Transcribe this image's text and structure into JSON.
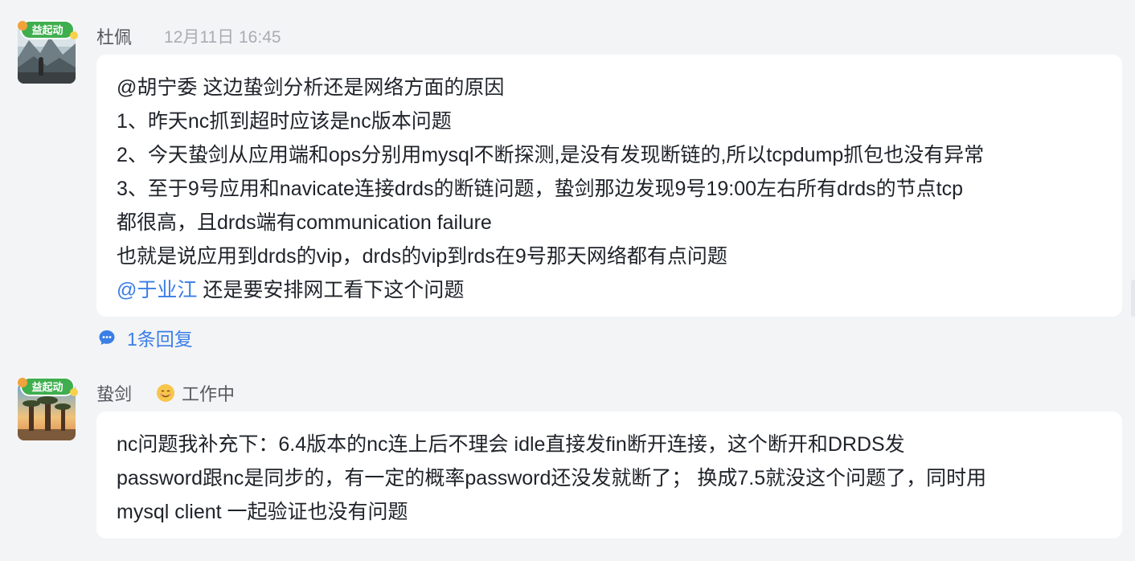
{
  "messages": [
    {
      "sender": "杜佩",
      "time": "12月11日 16:45",
      "badge": "益起动",
      "lines": [
        [
          {
            "text": "@胡宁委 这边蛰剑分析还是网络方面的原因"
          }
        ],
        [
          {
            "text": "1、昨天nc抓到超时应该是nc版本问题"
          }
        ],
        [
          {
            "text": "2、今天蛰剑从应用端和ops分别用mysql不断探测,是没有发现断链的,所以tcpdump抓包也没有异常"
          }
        ],
        [
          {
            "text": "3、至于9号应用和navicate连接drds的断链问题，蛰剑那边发现9号19:00左右所有drds的节点tcp"
          }
        ],
        [
          {
            "text": "都很高，且drds端有communication failure"
          }
        ],
        [
          {
            "text": "也就是说应用到drds的vip，drds的vip到rds在9号那天网络都有点问题"
          }
        ],
        [
          {
            "text": "@于业江",
            "mention": true
          },
          {
            "text": " 还是要安排网工看下这个问题"
          }
        ]
      ],
      "reply_label": "1条回复"
    },
    {
      "sender": "蛰剑",
      "status": "工作中",
      "badge": "益起动",
      "lines": [
        [
          {
            "text": "nc问题我补充下：6.4版本的nc连上后不理会 idle直接发fin断开连接，这个断开和DRDS发"
          }
        ],
        [
          {
            "text": "password跟nc是同步的，有一定的概率password还没发就断了；  换成7.5就没这个问题了，同时用"
          }
        ],
        [
          {
            "text": "mysql client 一起验证也没有问题"
          }
        ]
      ]
    }
  ],
  "colors": {
    "background": "#f3f4f6",
    "bubble": "#ffffff",
    "text": "#1f2329",
    "meta": "#55585e",
    "time": "#a9acb2",
    "link": "#3a7ee6",
    "badge": "#3fae4e"
  },
  "icons": {
    "reply": "comment-bubble-icon",
    "status": "smile-emoji-icon"
  }
}
